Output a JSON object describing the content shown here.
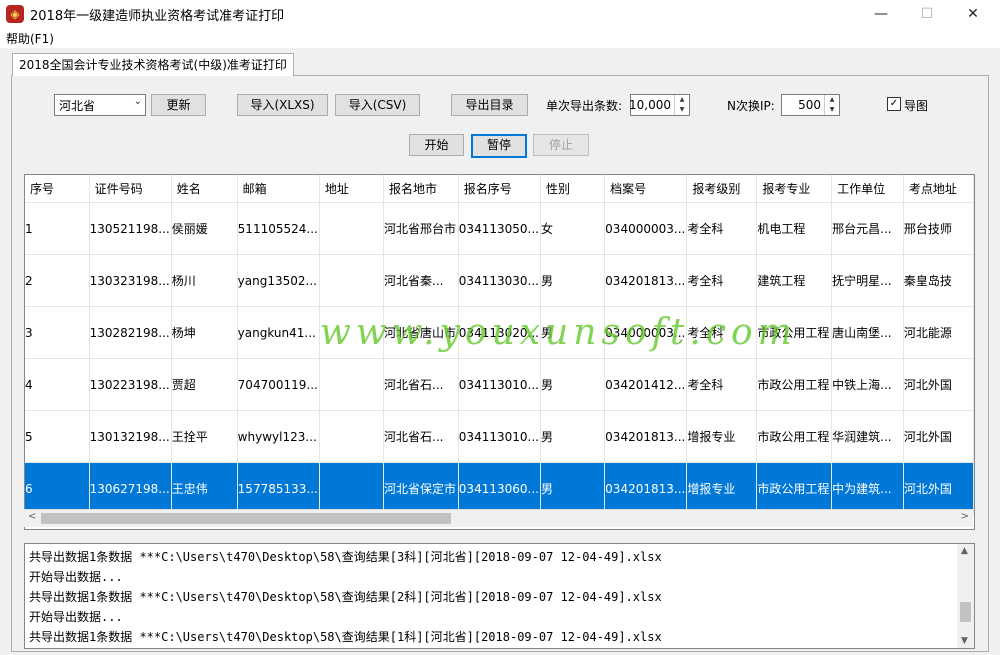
{
  "window": {
    "title": "2018年一级建造师执业资格考试准考证打印",
    "icon": "app-logo-icon",
    "minimize": "—",
    "maximize": "☐",
    "close": "✕"
  },
  "menu": {
    "help": "帮助(F1)"
  },
  "tab": {
    "label": "2018全国会计专业技术资格考试(中级)准考证打印"
  },
  "toolbar": {
    "province": "河北省",
    "update": "更新",
    "import_xlxs": "导入(XLXS)",
    "import_csv": "导入(CSV)",
    "export_dir": "导出目录",
    "batch_label": "单次导出条数:",
    "batch_value": "10,000",
    "ip_label": "N次换IP:",
    "ip_value": "500",
    "export_image_label": "导图",
    "export_image_checked": true,
    "start": "开始",
    "pause": "暂停",
    "stop": "停止"
  },
  "grid": {
    "columns": [
      "序号",
      "证件号码",
      "姓名",
      "邮箱",
      "地址",
      "报名地市",
      "报名序号",
      "性别",
      "档案号",
      "报考级别",
      "报考专业",
      "工作单位",
      "考点地址"
    ],
    "rows": [
      [
        "1",
        "130521198...",
        "侯丽媛",
        "511105524...",
        "",
        "河北省邢台市",
        "034113050...",
        "女",
        "034000003...",
        "考全科",
        "机电工程",
        "邢台元昌...",
        "邢台技师"
      ],
      [
        "2",
        "130323198...",
        "杨川",
        "yang13502...",
        "",
        "河北省秦...",
        "034113030...",
        "男",
        "034201813...",
        "考全科",
        "建筑工程",
        "抚宁明星...",
        "秦皇岛技"
      ],
      [
        "3",
        "130282198...",
        "杨坤",
        "yangkun41...",
        "",
        "河北省唐山市",
        "034113020...",
        "男",
        "034000003...",
        "考全科",
        "市政公用工程",
        "唐山南堡...",
        "河北能源"
      ],
      [
        "4",
        "130223198...",
        "贾超",
        "704700119...",
        "",
        "河北省石...",
        "034113010...",
        "男",
        "034201412...",
        "考全科",
        "市政公用工程",
        "中铁上海...",
        "河北外国"
      ],
      [
        "5",
        "130132198...",
        "王拴平",
        "whywyl123...",
        "",
        "河北省石...",
        "034113010...",
        "男",
        "034201813...",
        "增报专业",
        "市政公用工程",
        "华润建筑...",
        "河北外国"
      ],
      [
        "6",
        "130627198...",
        "王忠伟",
        "157785133...",
        "",
        "河北省保定市",
        "034113060...",
        "男",
        "034201813...",
        "增报专业",
        "市政公用工程",
        "中为建筑...",
        "河北外国"
      ]
    ],
    "selected_row": 6
  },
  "watermark": "www.youxunsoft.com",
  "log": [
    "共导出数据1条数据 ***C:\\Users\\t470\\Desktop\\58\\查询结果[3科][河北省][2018-09-07 12-04-49].xlsx",
    "开始导出数据...",
    "共导出数据1条数据 ***C:\\Users\\t470\\Desktop\\58\\查询结果[2科][河北省][2018-09-07 12-04-49].xlsx",
    "开始导出数据...",
    "共导出数据1条数据 ***C:\\Users\\t470\\Desktop\\58\\查询结果[1科][河北省][2018-09-07 12-04-49].xlsx"
  ],
  "colors": {
    "selection": "#0078d7",
    "watermark": "#62c828",
    "focus_border": "#0078d7"
  }
}
